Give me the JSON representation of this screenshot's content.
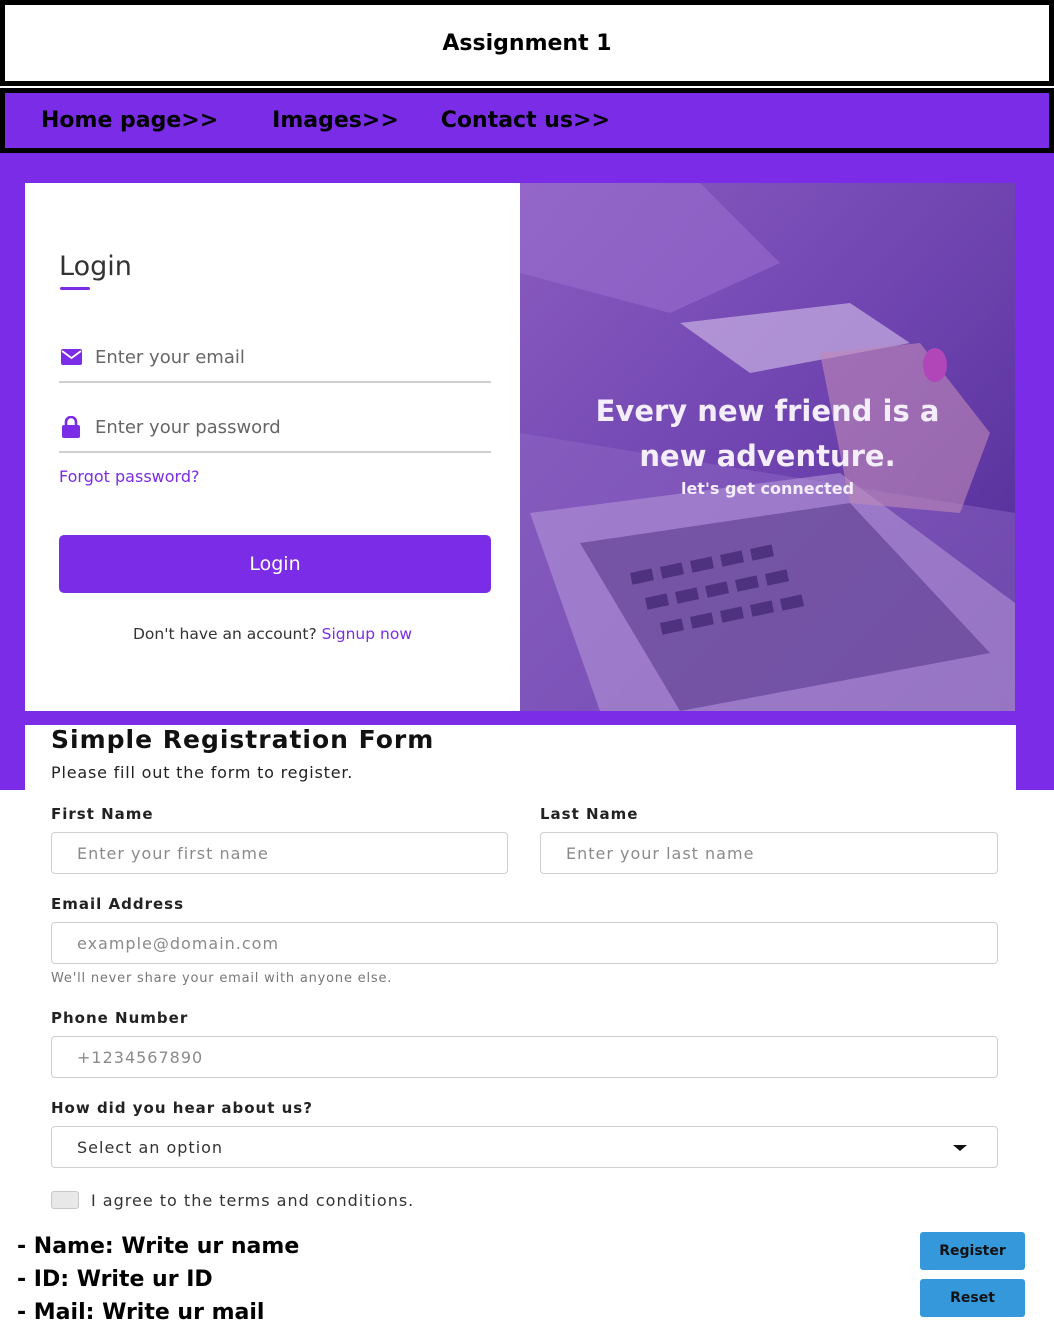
{
  "header": {
    "title": "Assignment 1"
  },
  "nav": {
    "home": "Home page>>",
    "images": "Images>>",
    "contact": "Contact us>>"
  },
  "login": {
    "title": "Login",
    "email_placeholder": "Enter your email",
    "password_placeholder": "Enter your password",
    "forgot": "Forgot password?",
    "button": "Login",
    "no_account": "Don't have an account? ",
    "signup": "Signup now"
  },
  "hero": {
    "line1": "Every new friend is a",
    "line2": "new adventure.",
    "sub": "let's get connected"
  },
  "registration": {
    "title": "Simple Registration Form",
    "subtitle": "Please fill out the form to register.",
    "first_name_label": "First Name",
    "first_name_placeholder": "Enter your first name",
    "last_name_label": "Last Name",
    "last_name_placeholder": "Enter your last name",
    "email_label": "Email Address",
    "email_placeholder": "example@domain.com",
    "email_help": "We'll never share your email with anyone else.",
    "phone_label": "Phone Number",
    "phone_placeholder": "+1234567890",
    "source_label": "How did you hear about us?",
    "source_selected": "Select an option",
    "terms": "I agree to the terms and conditions."
  },
  "footer": {
    "name": "- Name: Write ur name",
    "id": "- ID: Write ur ID",
    "mail": "- Mail: Write ur mail",
    "register": "Register",
    "reset": "Reset"
  },
  "colors": {
    "accent": "#7b2ce6",
    "button_blue": "#3498db"
  },
  "icons": {
    "email": "envelope-icon",
    "password": "lock-icon",
    "select": "caret-down-icon"
  }
}
